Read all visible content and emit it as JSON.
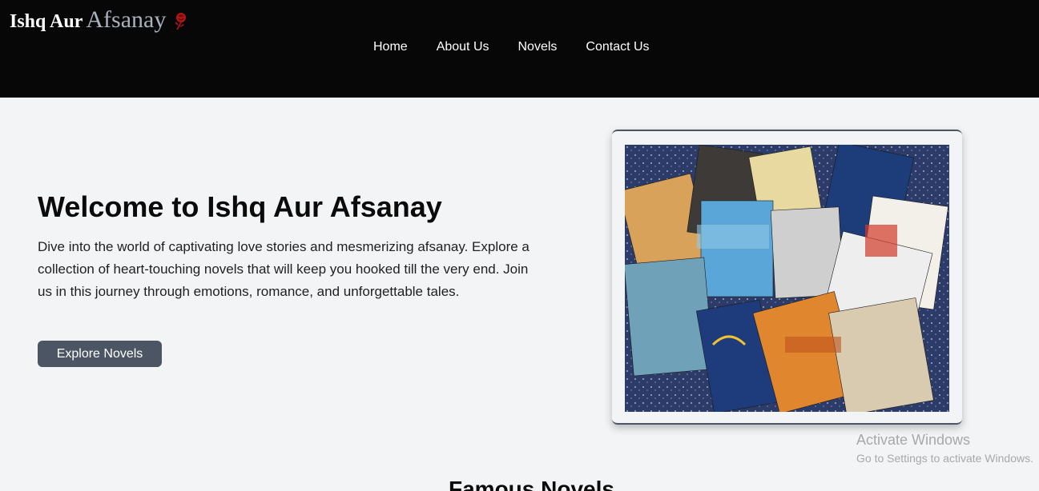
{
  "header": {
    "logo_part1": "Ishq Aur",
    "logo_part2": "Afsanay",
    "nav": [
      "Home",
      "About Us",
      "Novels",
      "Contact Us"
    ]
  },
  "hero": {
    "title": "Welcome to Ishq Aur Afsanay",
    "description": "Dive into the world of captivating love stories and mesmerizing afsanay. Explore a collection of heart-touching novels that will keep you hooked till the very end. Join us in this journey through emotions, romance, and unforgettable tales.",
    "button_label": "Explore Novels",
    "image_icon": "novels-collection-image"
  },
  "watermark": {
    "line1": "Activate Windows",
    "line2": "Go to Settings to activate Windows."
  },
  "famous": {
    "title": "Famous Novels"
  },
  "colors": {
    "header_bg": "#070707",
    "page_bg": "#f3f4f6",
    "button_bg": "#4b5563",
    "rose": "#b01818"
  }
}
